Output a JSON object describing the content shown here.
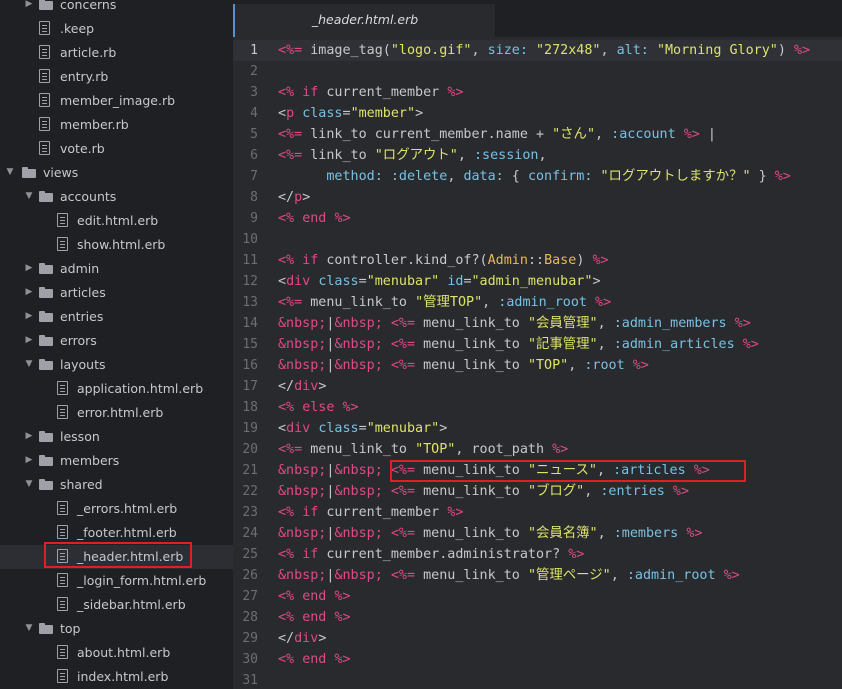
{
  "sidebar": {
    "items": [
      {
        "label": "concerns",
        "type": "folder",
        "depth": 2,
        "open": false,
        "chevron": true
      },
      {
        "label": ".keep",
        "type": "file",
        "depth": 2
      },
      {
        "label": "article.rb",
        "type": "file",
        "depth": 2
      },
      {
        "label": "entry.rb",
        "type": "file",
        "depth": 2
      },
      {
        "label": "member_image.rb",
        "type": "file",
        "depth": 2
      },
      {
        "label": "member.rb",
        "type": "file",
        "depth": 2
      },
      {
        "label": "vote.rb",
        "type": "file",
        "depth": 2
      },
      {
        "label": "views",
        "type": "folder",
        "depth": 1,
        "open": true,
        "chevron": true
      },
      {
        "label": "accounts",
        "type": "folder",
        "depth": 2,
        "open": true,
        "chevron": true
      },
      {
        "label": "edit.html.erb",
        "type": "file",
        "depth": 3
      },
      {
        "label": "show.html.erb",
        "type": "file",
        "depth": 3
      },
      {
        "label": "admin",
        "type": "folder",
        "depth": 2,
        "open": false,
        "chevron": true
      },
      {
        "label": "articles",
        "type": "folder",
        "depth": 2,
        "open": false,
        "chevron": true
      },
      {
        "label": "entries",
        "type": "folder",
        "depth": 2,
        "open": false,
        "chevron": true
      },
      {
        "label": "errors",
        "type": "folder",
        "depth": 2,
        "open": false,
        "chevron": true
      },
      {
        "label": "layouts",
        "type": "folder",
        "depth": 2,
        "open": true,
        "chevron": true
      },
      {
        "label": "application.html.erb",
        "type": "file",
        "depth": 3
      },
      {
        "label": "error.html.erb",
        "type": "file",
        "depth": 3
      },
      {
        "label": "lesson",
        "type": "folder",
        "depth": 2,
        "open": false,
        "chevron": true
      },
      {
        "label": "members",
        "type": "folder",
        "depth": 2,
        "open": false,
        "chevron": true
      },
      {
        "label": "shared",
        "type": "folder",
        "depth": 2,
        "open": true,
        "chevron": true
      },
      {
        "label": "_errors.html.erb",
        "type": "file",
        "depth": 3
      },
      {
        "label": "_footer.html.erb",
        "type": "file",
        "depth": 3
      },
      {
        "label": "_header.html.erb",
        "type": "file",
        "depth": 3,
        "selected": true
      },
      {
        "label": "_login_form.html.erb",
        "type": "file",
        "depth": 3
      },
      {
        "label": "_sidebar.html.erb",
        "type": "file",
        "depth": 3
      },
      {
        "label": "top",
        "type": "folder",
        "depth": 2,
        "open": true,
        "chevron": true
      },
      {
        "label": "about.html.erb",
        "type": "file",
        "depth": 3
      },
      {
        "label": "index.html.erb",
        "type": "file",
        "depth": 3
      }
    ]
  },
  "tab": {
    "label": "_header.html.erb"
  },
  "colors": {
    "keyword": "#dd4b87",
    "string": "#dde36a",
    "symbol": "#78c1e3",
    "constant": "#e8b95a",
    "text": "#c6c8ca",
    "highlight_box": "#e02020"
  },
  "editor": {
    "current_line": 1,
    "lines": [
      {
        "n": "1",
        "t": [
          [
            "x",
            "<%="
          ],
          [
            "p",
            " image_tag("
          ],
          [
            "s",
            "\"logo.gif\""
          ],
          [
            "p",
            ", "
          ],
          [
            "m",
            "size:"
          ],
          [
            "p",
            " "
          ],
          [
            "s",
            "\"272x48\""
          ],
          [
            "p",
            ", "
          ],
          [
            "m",
            "alt:"
          ],
          [
            "p",
            " "
          ],
          [
            "s",
            "\"Morning Glory\""
          ],
          [
            "p",
            ") "
          ],
          [
            "x",
            "%>"
          ]
        ]
      },
      {
        "n": "2",
        "t": []
      },
      {
        "n": "3",
        "t": [
          [
            "x",
            "<%"
          ],
          [
            "p",
            " "
          ],
          [
            "k",
            "if"
          ],
          [
            "p",
            " current_member "
          ],
          [
            "x",
            "%>"
          ]
        ]
      },
      {
        "n": "4",
        "t": [
          [
            "p",
            "<"
          ],
          [
            "k",
            "p"
          ],
          [
            "p",
            " "
          ],
          [
            "m",
            "class"
          ],
          [
            "p",
            "="
          ],
          [
            "s",
            "\"member\""
          ],
          [
            "p",
            ">"
          ]
        ]
      },
      {
        "n": "5",
        "t": [
          [
            "x",
            "<%="
          ],
          [
            "p",
            " link_to current_member.name + "
          ],
          [
            "s",
            "\"さん\""
          ],
          [
            "p",
            ", "
          ],
          [
            "m",
            ":account"
          ],
          [
            "p",
            " "
          ],
          [
            "x",
            "%>"
          ],
          [
            "p",
            " |"
          ]
        ]
      },
      {
        "n": "6",
        "t": [
          [
            "x",
            "<%="
          ],
          [
            "p",
            " link_to "
          ],
          [
            "s",
            "\"ログアウト\""
          ],
          [
            "p",
            ", "
          ],
          [
            "m",
            ":session"
          ],
          [
            "p",
            ","
          ]
        ]
      },
      {
        "n": "7",
        "t": [
          [
            "p",
            "      "
          ],
          [
            "m",
            "method:"
          ],
          [
            "p",
            " "
          ],
          [
            "m",
            ":delete"
          ],
          [
            "p",
            ", "
          ],
          [
            "m",
            "data:"
          ],
          [
            "p",
            " { "
          ],
          [
            "m",
            "confirm:"
          ],
          [
            "p",
            " "
          ],
          [
            "s",
            "\"ログアウトしますか？\""
          ],
          [
            "p",
            " } "
          ],
          [
            "x",
            "%>"
          ]
        ]
      },
      {
        "n": "8",
        "t": [
          [
            "p",
            "</"
          ],
          [
            "k",
            "p"
          ],
          [
            "p",
            ">"
          ]
        ]
      },
      {
        "n": "9",
        "t": [
          [
            "x",
            "<%"
          ],
          [
            "p",
            " "
          ],
          [
            "k",
            "end"
          ],
          [
            "p",
            " "
          ],
          [
            "x",
            "%>"
          ]
        ]
      },
      {
        "n": "10",
        "t": []
      },
      {
        "n": "11",
        "t": [
          [
            "x",
            "<%"
          ],
          [
            "p",
            " "
          ],
          [
            "k",
            "if"
          ],
          [
            "p",
            " controller.kind_of?("
          ],
          [
            "c",
            "Admin"
          ],
          [
            "p",
            "::"
          ],
          [
            "c",
            "Base"
          ],
          [
            "p",
            ") "
          ],
          [
            "x",
            "%>"
          ]
        ]
      },
      {
        "n": "12",
        "t": [
          [
            "p",
            "<"
          ],
          [
            "k",
            "div"
          ],
          [
            "p",
            " "
          ],
          [
            "m",
            "class"
          ],
          [
            "p",
            "="
          ],
          [
            "s",
            "\"menubar\""
          ],
          [
            "p",
            " "
          ],
          [
            "m",
            "id"
          ],
          [
            "p",
            "="
          ],
          [
            "s",
            "\"admin_menubar\""
          ],
          [
            "p",
            ">"
          ]
        ]
      },
      {
        "n": "13",
        "t": [
          [
            "x",
            "<%="
          ],
          [
            "p",
            " menu_link_to "
          ],
          [
            "s",
            "\"管理TOP\""
          ],
          [
            "p",
            ", "
          ],
          [
            "m",
            ":admin_root"
          ],
          [
            "p",
            " "
          ],
          [
            "x",
            "%>"
          ]
        ]
      },
      {
        "n": "14",
        "t": [
          [
            "x",
            "&nbsp;"
          ],
          [
            "p",
            "|"
          ],
          [
            "x",
            "&nbsp;"
          ],
          [
            "p",
            " "
          ],
          [
            "x",
            "<%="
          ],
          [
            "p",
            " menu_link_to "
          ],
          [
            "s",
            "\"会員管理\""
          ],
          [
            "p",
            ", "
          ],
          [
            "m",
            ":admin_members"
          ],
          [
            "p",
            " "
          ],
          [
            "x",
            "%>"
          ]
        ]
      },
      {
        "n": "15",
        "t": [
          [
            "x",
            "&nbsp;"
          ],
          [
            "p",
            "|"
          ],
          [
            "x",
            "&nbsp;"
          ],
          [
            "p",
            " "
          ],
          [
            "x",
            "<%="
          ],
          [
            "p",
            " menu_link_to "
          ],
          [
            "s",
            "\"記事管理\""
          ],
          [
            "p",
            ", "
          ],
          [
            "m",
            ":admin_articles"
          ],
          [
            "p",
            " "
          ],
          [
            "x",
            "%>"
          ]
        ]
      },
      {
        "n": "16",
        "t": [
          [
            "x",
            "&nbsp;"
          ],
          [
            "p",
            "|"
          ],
          [
            "x",
            "&nbsp;"
          ],
          [
            "p",
            " "
          ],
          [
            "x",
            "<%="
          ],
          [
            "p",
            " menu_link_to "
          ],
          [
            "s",
            "\"TOP\""
          ],
          [
            "p",
            ", "
          ],
          [
            "m",
            ":root"
          ],
          [
            "p",
            " "
          ],
          [
            "x",
            "%>"
          ]
        ]
      },
      {
        "n": "17",
        "t": [
          [
            "p",
            "</"
          ],
          [
            "k",
            "div"
          ],
          [
            "p",
            ">"
          ]
        ]
      },
      {
        "n": "18",
        "t": [
          [
            "x",
            "<%"
          ],
          [
            "p",
            " "
          ],
          [
            "k",
            "else"
          ],
          [
            "p",
            " "
          ],
          [
            "x",
            "%>"
          ]
        ]
      },
      {
        "n": "19",
        "t": [
          [
            "p",
            "<"
          ],
          [
            "k",
            "div"
          ],
          [
            "p",
            " "
          ],
          [
            "m",
            "class"
          ],
          [
            "p",
            "="
          ],
          [
            "s",
            "\"menubar\""
          ],
          [
            "p",
            ">"
          ]
        ]
      },
      {
        "n": "20",
        "t": [
          [
            "x",
            "<%="
          ],
          [
            "p",
            " menu_link_to "
          ],
          [
            "s",
            "\"TOP\""
          ],
          [
            "p",
            ", root_path "
          ],
          [
            "x",
            "%>"
          ]
        ]
      },
      {
        "n": "21",
        "t": [
          [
            "x",
            "&nbsp;"
          ],
          [
            "p",
            "|"
          ],
          [
            "x",
            "&nbsp;"
          ],
          [
            "p",
            " "
          ],
          [
            "x",
            "<%="
          ],
          [
            "p",
            " menu_link_to "
          ],
          [
            "s",
            "\"ニュース\""
          ],
          [
            "p",
            ", "
          ],
          [
            "m",
            ":articles"
          ],
          [
            "p",
            " "
          ],
          [
            "x",
            "%>"
          ]
        ]
      },
      {
        "n": "22",
        "t": [
          [
            "x",
            "&nbsp;"
          ],
          [
            "p",
            "|"
          ],
          [
            "x",
            "&nbsp;"
          ],
          [
            "p",
            " "
          ],
          [
            "x",
            "<%="
          ],
          [
            "p",
            " menu_link_to "
          ],
          [
            "s",
            "\"ブログ\""
          ],
          [
            "p",
            ", "
          ],
          [
            "m",
            ":entries"
          ],
          [
            "p",
            " "
          ],
          [
            "x",
            "%>"
          ]
        ]
      },
      {
        "n": "23",
        "t": [
          [
            "x",
            "<%"
          ],
          [
            "p",
            " "
          ],
          [
            "k",
            "if"
          ],
          [
            "p",
            " current_member "
          ],
          [
            "x",
            "%>"
          ]
        ]
      },
      {
        "n": "24",
        "t": [
          [
            "x",
            "&nbsp;"
          ],
          [
            "p",
            "|"
          ],
          [
            "x",
            "&nbsp;"
          ],
          [
            "p",
            " "
          ],
          [
            "x",
            "<%="
          ],
          [
            "p",
            " menu_link_to "
          ],
          [
            "s",
            "\"会員名簿\""
          ],
          [
            "p",
            ", "
          ],
          [
            "m",
            ":members"
          ],
          [
            "p",
            " "
          ],
          [
            "x",
            "%>"
          ]
        ]
      },
      {
        "n": "25",
        "t": [
          [
            "x",
            "<%"
          ],
          [
            "p",
            " "
          ],
          [
            "k",
            "if"
          ],
          [
            "p",
            " current_member.administrator? "
          ],
          [
            "x",
            "%>"
          ]
        ]
      },
      {
        "n": "26",
        "t": [
          [
            "x",
            "&nbsp;"
          ],
          [
            "p",
            "|"
          ],
          [
            "x",
            "&nbsp;"
          ],
          [
            "p",
            " "
          ],
          [
            "x",
            "<%="
          ],
          [
            "p",
            " menu_link_to "
          ],
          [
            "s",
            "\"管理ページ\""
          ],
          [
            "p",
            ", "
          ],
          [
            "m",
            ":admin_root"
          ],
          [
            "p",
            " "
          ],
          [
            "x",
            "%>"
          ]
        ]
      },
      {
        "n": "27",
        "t": [
          [
            "x",
            "<%"
          ],
          [
            "p",
            " "
          ],
          [
            "k",
            "end"
          ],
          [
            "p",
            " "
          ],
          [
            "x",
            "%>"
          ]
        ]
      },
      {
        "n": "28",
        "t": [
          [
            "x",
            "<%"
          ],
          [
            "p",
            " "
          ],
          [
            "k",
            "end"
          ],
          [
            "p",
            " "
          ],
          [
            "x",
            "%>"
          ]
        ]
      },
      {
        "n": "29",
        "t": [
          [
            "p",
            "</"
          ],
          [
            "k",
            "div"
          ],
          [
            "p",
            ">"
          ]
        ]
      },
      {
        "n": "30",
        "t": [
          [
            "x",
            "<%"
          ],
          [
            "p",
            " "
          ],
          [
            "k",
            "end"
          ],
          [
            "p",
            " "
          ],
          [
            "x",
            "%>"
          ]
        ]
      },
      {
        "n": "31",
        "t": []
      }
    ]
  }
}
